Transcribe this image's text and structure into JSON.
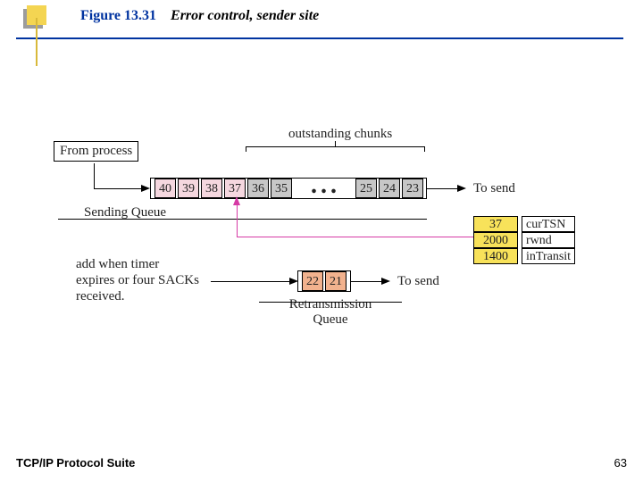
{
  "figure_label": "Figure 13.31",
  "figure_title": "Error control, sender site",
  "labels": {
    "from_process": "From process",
    "sending_queue": "Sending Queue",
    "outstanding": "outstanding chunks",
    "to_send_1": "To send",
    "to_send_2": "To send",
    "retrans_queue": "Retransmission\nQueue",
    "add_note_l1": "add when timer",
    "add_note_l2": "expires or four SACKs",
    "add_note_l3": "received.",
    "dots": "..."
  },
  "sending_queue": {
    "pink_cells": [
      "40",
      "39",
      "38",
      "37"
    ],
    "grey_left": [
      "36",
      "35"
    ],
    "grey_right": [
      "25",
      "24",
      "23"
    ]
  },
  "retrans_queue": [
    "22",
    "21"
  ],
  "params": {
    "rows": [
      {
        "value": "37",
        "name": "curTSN"
      },
      {
        "value": "2000",
        "name": "rwnd"
      },
      {
        "value": "1400",
        "name": "inTransit"
      }
    ]
  },
  "footer": {
    "left": "TCP/IP Protocol Suite",
    "right": "63"
  }
}
